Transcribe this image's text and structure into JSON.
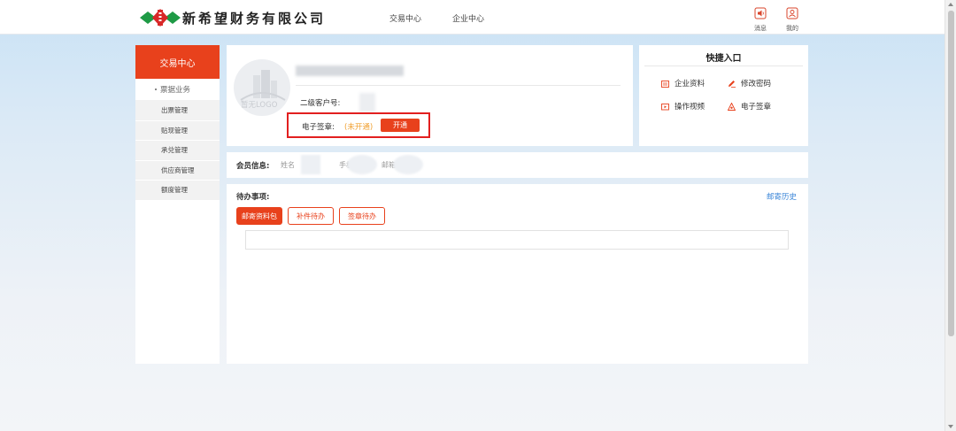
{
  "header": {
    "company_name": "新希望财务有限公司",
    "nav": [
      "交易中心",
      "企业中心"
    ],
    "icons": [
      {
        "name": "message-icon",
        "label": "消息"
      },
      {
        "name": "user-icon",
        "label": "我的"
      }
    ]
  },
  "sidebar": {
    "title": "交易中心",
    "group": "票据业务",
    "items": [
      "出票管理",
      "贴现管理",
      "承兑管理",
      "供应商管理",
      "额度管理"
    ]
  },
  "profile": {
    "logo_placeholder": "暂无LOGO",
    "client_no_label": "二级客户号:",
    "esign_label": "电子签章:",
    "esign_status": "(未开通)",
    "open_button": "开通"
  },
  "quick_entry": {
    "title": "快捷入口",
    "links": [
      {
        "icon": "document-icon",
        "label": "企业资料"
      },
      {
        "icon": "edit-icon",
        "label": "修改密码"
      },
      {
        "icon": "video-icon",
        "label": "操作视频"
      },
      {
        "icon": "seal-icon",
        "label": "电子签章"
      }
    ]
  },
  "member": {
    "label": "会员信息:",
    "fields": [
      "姓名",
      "手机",
      "邮箱"
    ]
  },
  "todo": {
    "label": "待办事项:",
    "history_link": "邮寄历史",
    "tabs": [
      "邮寄资料包",
      "补件待办",
      "签章待办"
    ],
    "active_tab": "邮寄资料包"
  },
  "colors": {
    "accent": "#e8411c",
    "highlight_border": "#e21f1f",
    "pending_status": "#f0a030",
    "link": "#3b86d8"
  }
}
